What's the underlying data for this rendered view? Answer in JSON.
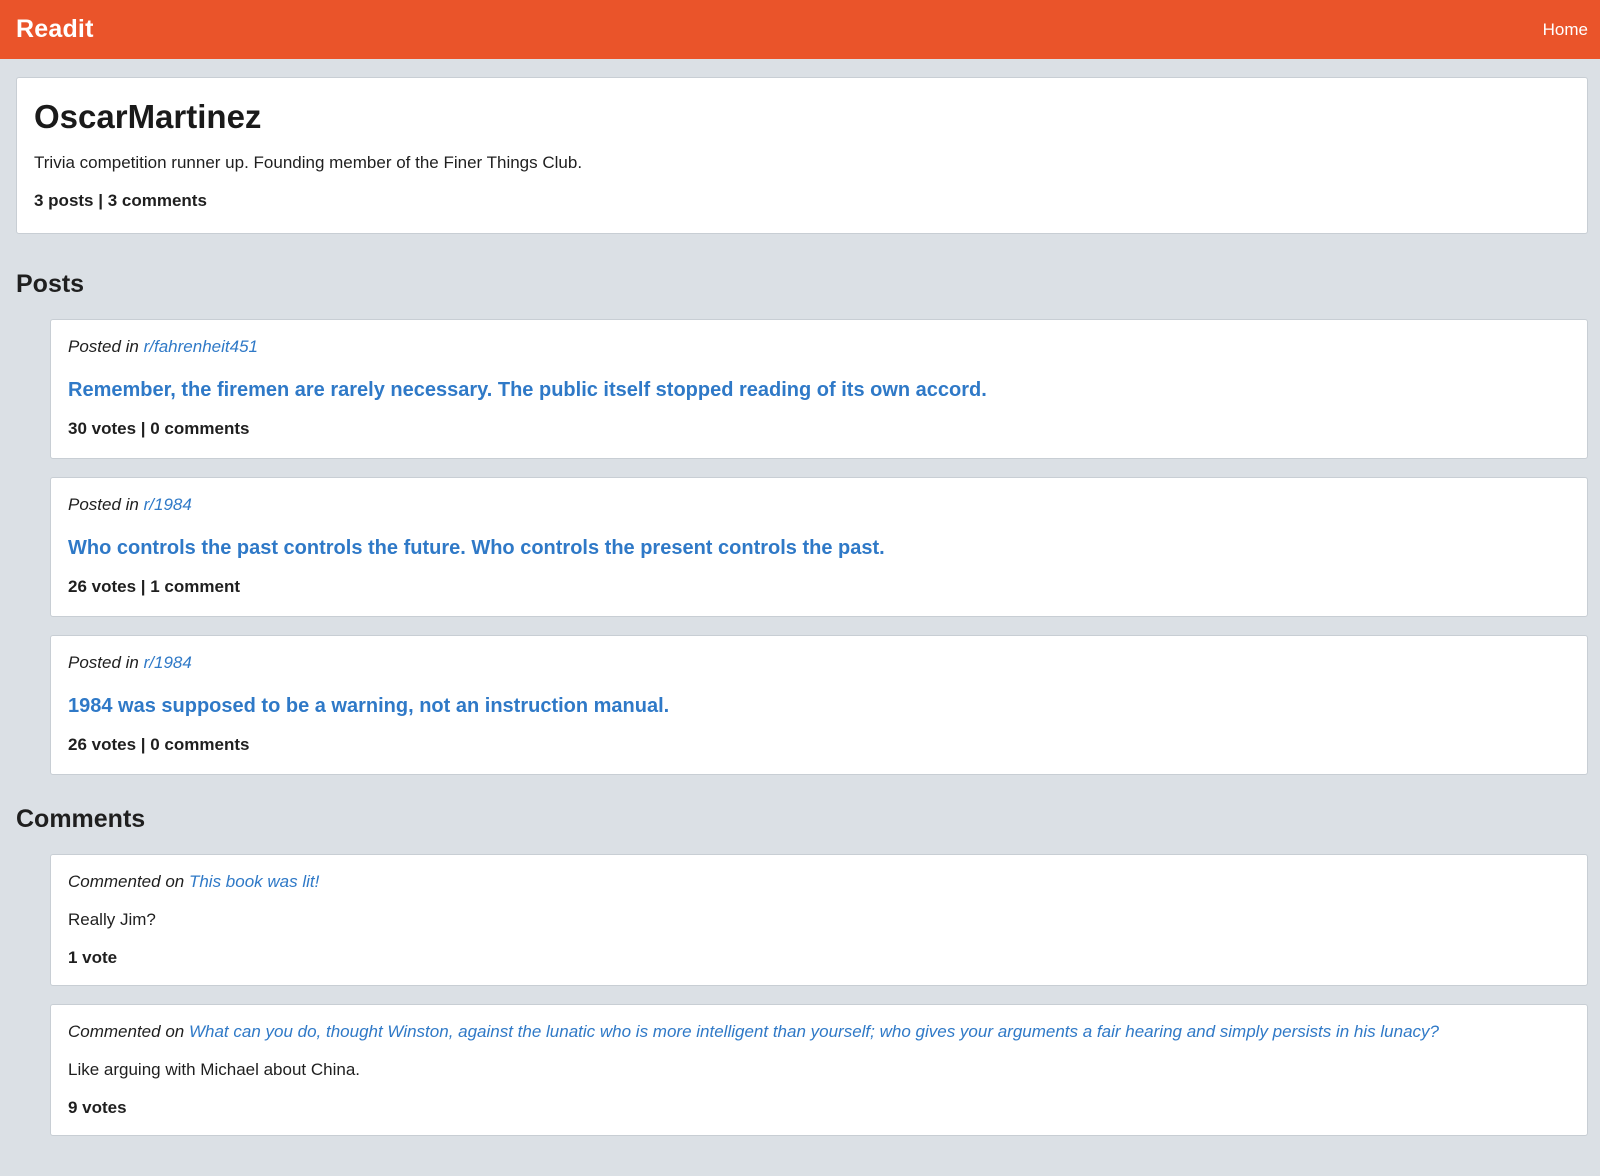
{
  "navbar": {
    "brand": "Readit",
    "home_label": "Home"
  },
  "profile": {
    "username": "OscarMartinez",
    "bio": "Trivia competition runner up. Founding member of the Finer Things Club.",
    "stats": "3 posts | 3 comments"
  },
  "posts_section": {
    "heading": "Posts",
    "items": [
      {
        "posted_in_label": "Posted in",
        "subreddit": "r/fahrenheit451",
        "title": "Remember, the firemen are rarely necessary. The public itself stopped reading of its own accord.",
        "stats": "30 votes | 0 comments"
      },
      {
        "posted_in_label": "Posted in",
        "subreddit": "r/1984",
        "title": "Who controls the past controls the future. Who controls the present controls the past.",
        "stats": "26 votes | 1 comment"
      },
      {
        "posted_in_label": "Posted in",
        "subreddit": "r/1984",
        "title": "1984 was supposed to be a warning, not an instruction manual.",
        "stats": "26 votes | 0 comments"
      }
    ]
  },
  "comments_section": {
    "heading": "Comments",
    "items": [
      {
        "commented_on_label": "Commented on",
        "post_title": "This book was lit!",
        "body": "Really Jim?",
        "votes": "1 vote"
      },
      {
        "commented_on_label": "Commented on",
        "post_title": "What can you do, thought Winston, against the lunatic who is more intelligent than yourself; who gives your arguments a fair hearing and simply persists in his lunacy?",
        "body": "Like arguing with Michael about China.",
        "votes": "9 votes"
      }
    ]
  },
  "colors": {
    "navbar": "#ea542a",
    "background": "#dbe0e5",
    "link": "#2f79c7"
  }
}
